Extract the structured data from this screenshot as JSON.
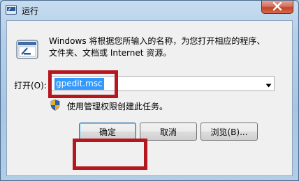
{
  "window": {
    "title": "运行",
    "close_icon": "close-icon"
  },
  "dialog": {
    "description": "Windows 将根据您所输入的名称，为您打开相应的程序、文件夹、文档或 Internet 资源。",
    "open_label": "打开(O):",
    "command_value": "gpedit.msc",
    "admin_note": "使用管理权限创建此任务。"
  },
  "buttons": {
    "ok": "确定",
    "cancel": "取消",
    "browse": "浏览(B)..."
  },
  "colors": {
    "highlight": "#b5171f",
    "selection": "#3399ff"
  }
}
